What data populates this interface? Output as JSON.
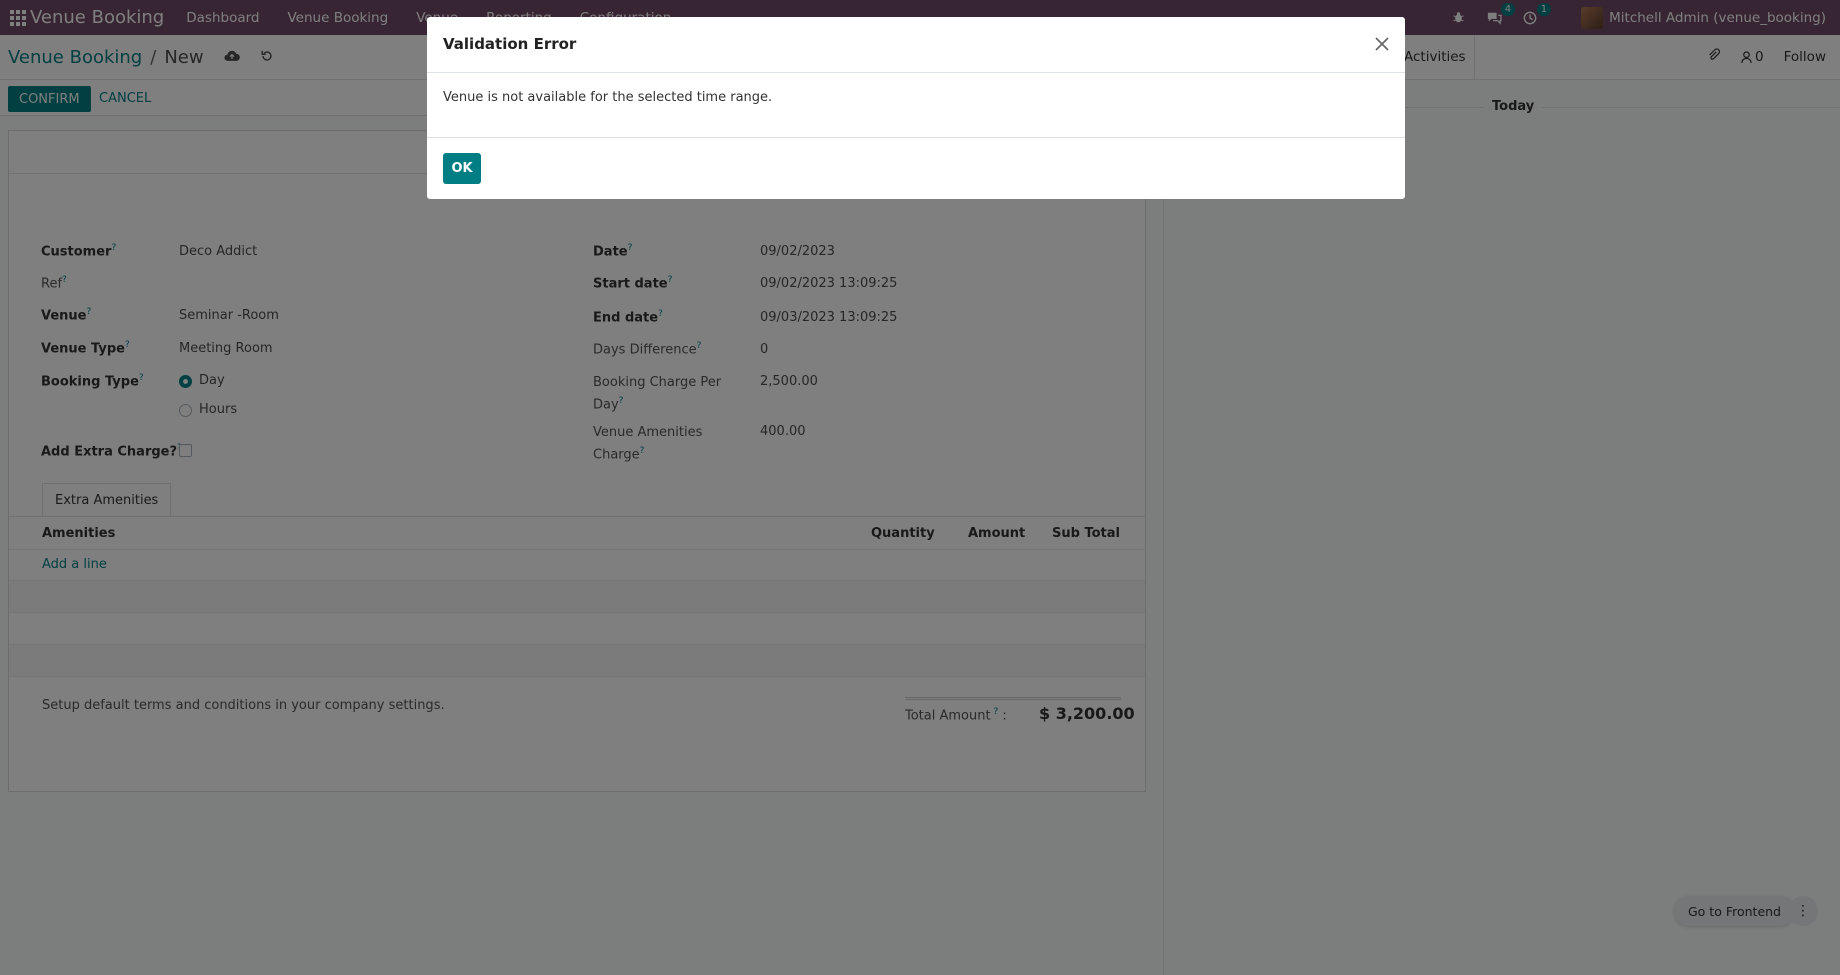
{
  "navbar": {
    "brand": "Venue Booking",
    "menu": [
      "Dashboard",
      "Venue Booking",
      "Venue",
      "Reporting",
      "Configuration"
    ],
    "messages_count": "4",
    "activities_count": "1",
    "user": "Mitchell Admin (venue_booking)"
  },
  "breadcrumb": {
    "parent": "Venue Booking",
    "separator": "/",
    "current": "New"
  },
  "status_buttons": {
    "confirm": "CONFIRM",
    "cancel": "CANCEL"
  },
  "chatter": {
    "activities": "Activities",
    "followers_count": "0",
    "follow": "Follow",
    "today": "Today"
  },
  "form": {
    "left": [
      {
        "label": "Customer",
        "value": "Deco Addict"
      },
      {
        "label": "Ref",
        "value": ""
      },
      {
        "label": "Venue",
        "value": "Seminar -Room"
      },
      {
        "label": "Venue Type",
        "value": "Meeting Room"
      }
    ],
    "booking_type": {
      "label": "Booking Type",
      "options": [
        "Day",
        "Hours"
      ],
      "selected": "Day"
    },
    "extra_charge": {
      "label": "Add Extra Charge?",
      "checked": false
    },
    "right": [
      {
        "label": "Date",
        "value": "09/02/2023"
      },
      {
        "label": "Start date",
        "value": "09/02/2023 13:09:25"
      },
      {
        "label": "End date",
        "value": "09/03/2023 13:09:25"
      },
      {
        "label": "Days Difference",
        "value": "0"
      },
      {
        "label": "Booking Charge Per Day",
        "value": "2,500.00"
      },
      {
        "label": "Venue Amenities Charge",
        "value": "400.00"
      }
    ],
    "tab": "Extra Amenities",
    "table": {
      "headers": [
        "Amenities",
        "Quantity",
        "Amount",
        "Sub Total"
      ],
      "add_line": "Add a line"
    },
    "terms": "Setup default terms and conditions in your company settings.",
    "total_label": "Total Amount",
    "total_value": "$ 3,200.00"
  },
  "frontend": {
    "button": "Go to Frontend"
  },
  "dialog": {
    "title": "Validation Error",
    "message": "Venue is not available for the selected time range.",
    "ok": "OK"
  },
  "colors": {
    "navbar": "#714b67",
    "primary": "#017e84"
  }
}
